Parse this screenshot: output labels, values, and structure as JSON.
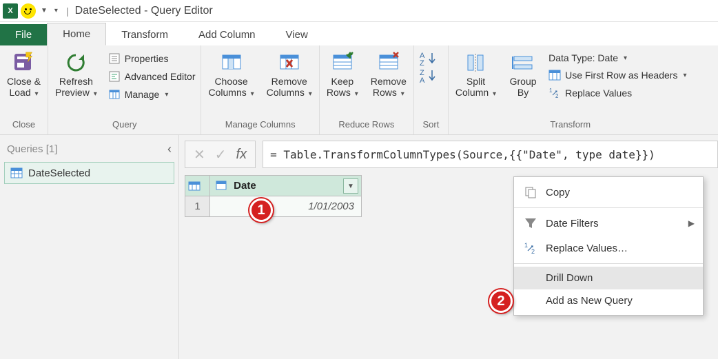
{
  "titlebar": {
    "title": "DateSelected - Query Editor"
  },
  "tabs": {
    "file": "File",
    "home": "Home",
    "transform": "Transform",
    "addColumn": "Add Column",
    "view": "View"
  },
  "ribbon": {
    "close": {
      "closeLoad": "Close &\nLoad",
      "group": "Close"
    },
    "query": {
      "refresh": "Refresh\nPreview",
      "properties": "Properties",
      "advEditor": "Advanced Editor",
      "manage": "Manage",
      "group": "Query"
    },
    "manageCols": {
      "choose": "Choose\nColumns",
      "remove": "Remove\nColumns",
      "group": "Manage Columns"
    },
    "reduceRows": {
      "keep": "Keep\nRows",
      "remove": "Remove\nRows",
      "group": "Reduce Rows"
    },
    "sort": {
      "group": "Sort"
    },
    "transform": {
      "split": "Split\nColumn",
      "groupBy": "Group\nBy",
      "dataType": "Data Type: Date",
      "firstRow": "Use First Row as Headers",
      "replace": "Replace Values",
      "group": "Transform"
    }
  },
  "queriesPane": {
    "header": "Queries [1]",
    "item1": "DateSelected"
  },
  "formula": {
    "text": "= Table.TransformColumnTypes(Source,{{\"Date\", type date}})"
  },
  "table": {
    "colName": "Date",
    "row1idx": "1",
    "row1val": "1/01/2003"
  },
  "contextMenu": {
    "copy": "Copy",
    "dateFilters": "Date Filters",
    "replace": "Replace Values…",
    "drillDown": "Drill Down",
    "addNewQuery": "Add as New Query"
  },
  "badges": {
    "b1": "1",
    "b2": "2"
  }
}
